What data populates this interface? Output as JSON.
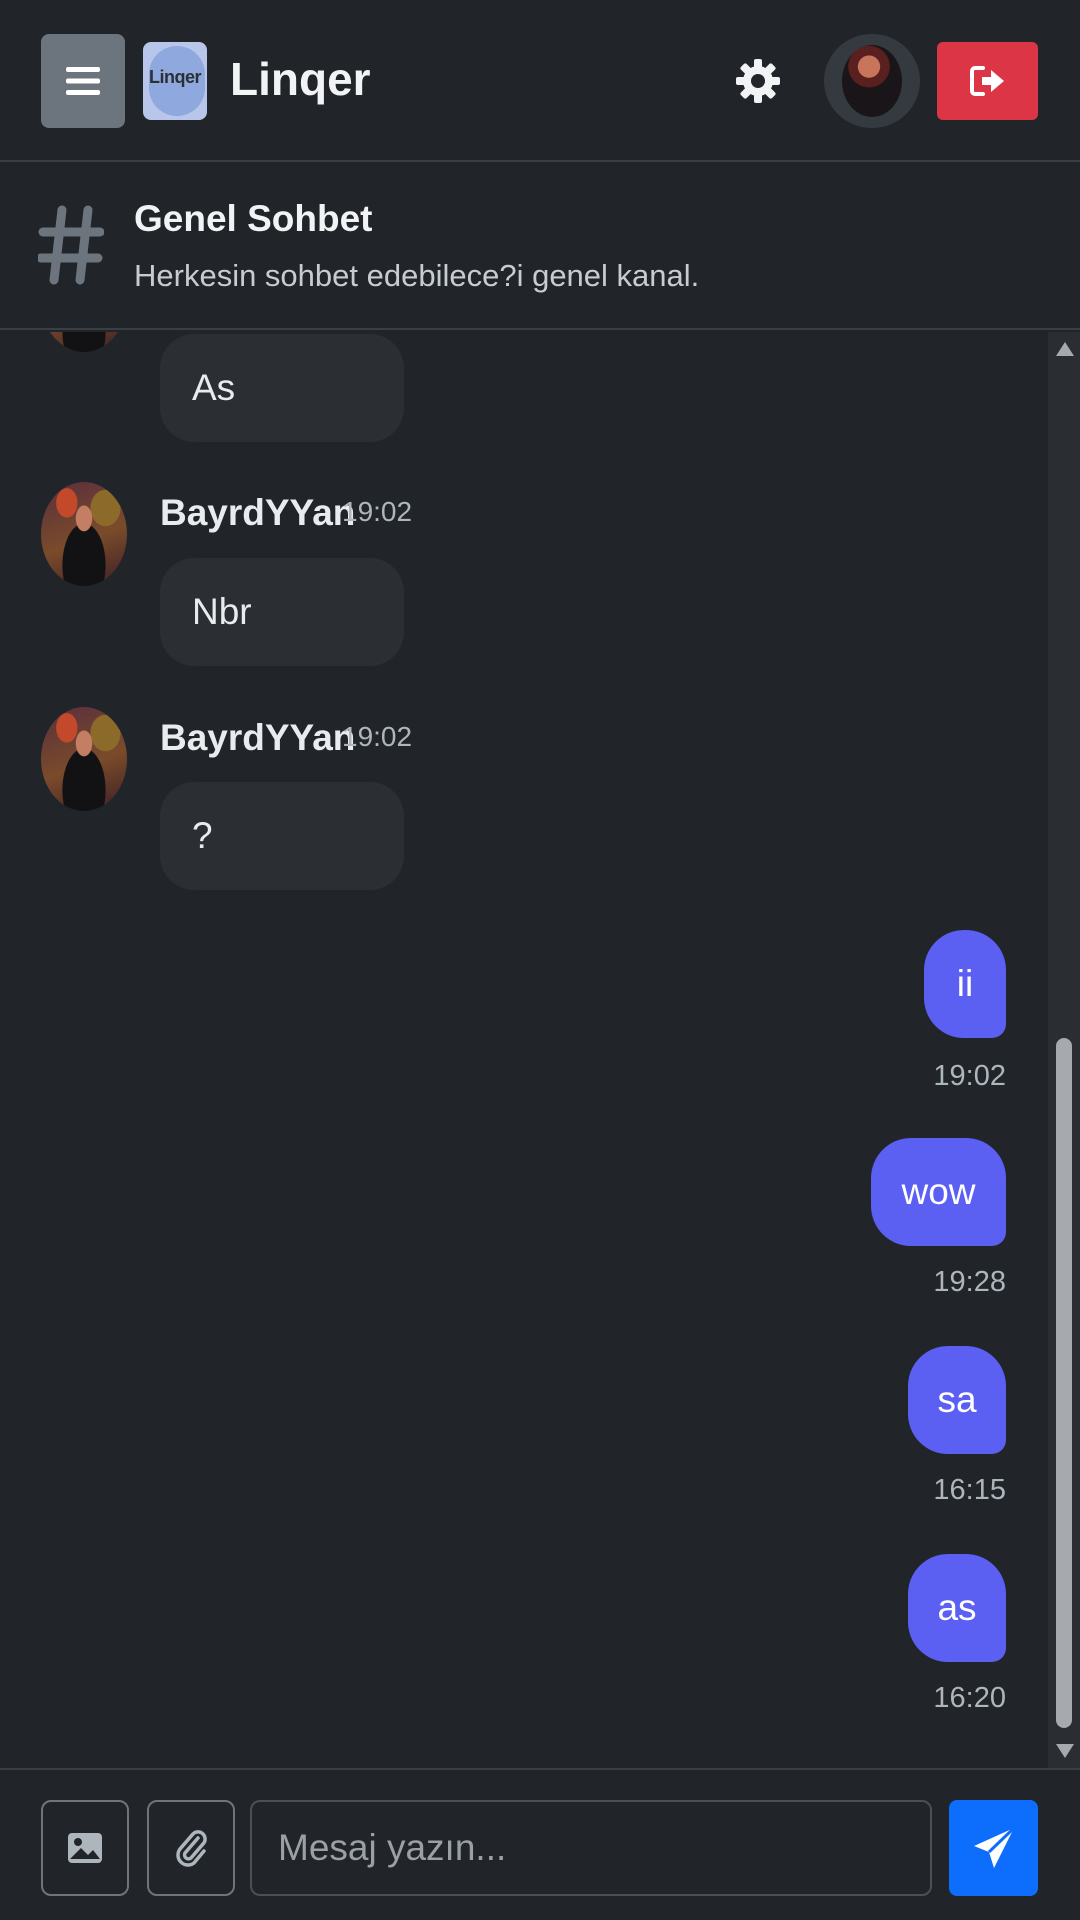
{
  "header": {
    "brand": "Linqer",
    "logo_text": "Linqer"
  },
  "channel": {
    "title": "Genel Sohbet",
    "description": "Herkesin sohbet edebilece?i genel kanal."
  },
  "messages_in": [
    {
      "text": "As"
    },
    {
      "user": "BayrdYYan",
      "time": "19:02",
      "text": "Nbr"
    },
    {
      "user": "BayrdYYan",
      "time": "19:02",
      "text": "?"
    }
  ],
  "messages_out": [
    {
      "text": "ii",
      "time": "19:02"
    },
    {
      "text": "wow",
      "time": "19:28"
    },
    {
      "text": "sa",
      "time": "16:15"
    },
    {
      "text": "as",
      "time": "16:20"
    }
  ],
  "composer": {
    "placeholder": "Mesaj yazın..."
  },
  "colors": {
    "background": "#212529",
    "accent_outgoing": "#5b5ff2",
    "logout": "#dc3545",
    "send": "#0d6efd"
  }
}
